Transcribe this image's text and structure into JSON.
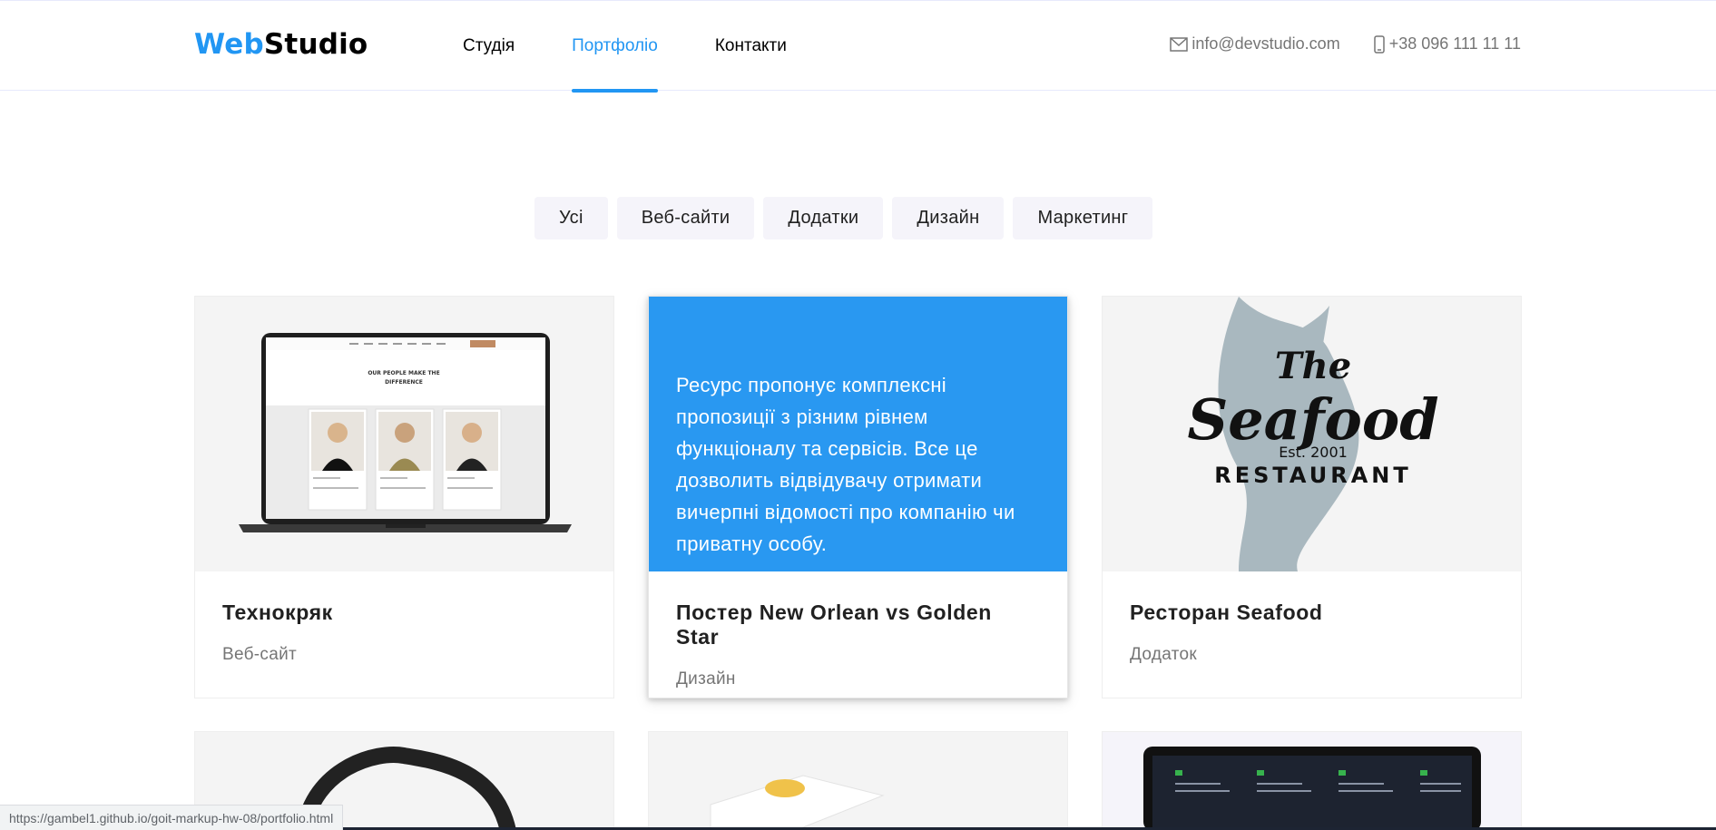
{
  "header": {
    "logo_part1": "Web",
    "logo_part2": "Studio",
    "nav": [
      {
        "label": "Студія"
      },
      {
        "label": "Портфоліо"
      },
      {
        "label": "Контакти"
      }
    ],
    "email": "info@devstudio.com",
    "phone": "+38 096 111 11 11"
  },
  "filters": [
    "Усі",
    "Веб-сайти",
    "Додатки",
    "Дизайн",
    "Маркетинг"
  ],
  "cards": [
    {
      "title": "Технокряк",
      "category": "Веб-сайт",
      "screen_heading": "OUR PEOPLE MAKE THE DIFFERENCE"
    },
    {
      "title": "Постер New Orlean vs Golden Star",
      "category": "Дизайн",
      "overlay_text": "Ресурс пропонує комплексні пропозиції з різним рівнем функціоналу та сервісів. Все це дозволить відвідувачу отримати вичерпні відомості про компанію чи приватну особу."
    },
    {
      "title": "Ресторан Seafood",
      "category": "Додаток",
      "logo": {
        "the": "The",
        "seafood": "Seafood",
        "est": "Est. 2001",
        "restaurant": "RESTAURANT"
      }
    }
  ],
  "status_url": "https://gambel1.github.io/goit-markup-hw-08/portfolio.html",
  "colors": {
    "accent": "#2196f3",
    "text": "#212121",
    "muted": "#757575",
    "filter_bg": "#f5f4fa"
  }
}
